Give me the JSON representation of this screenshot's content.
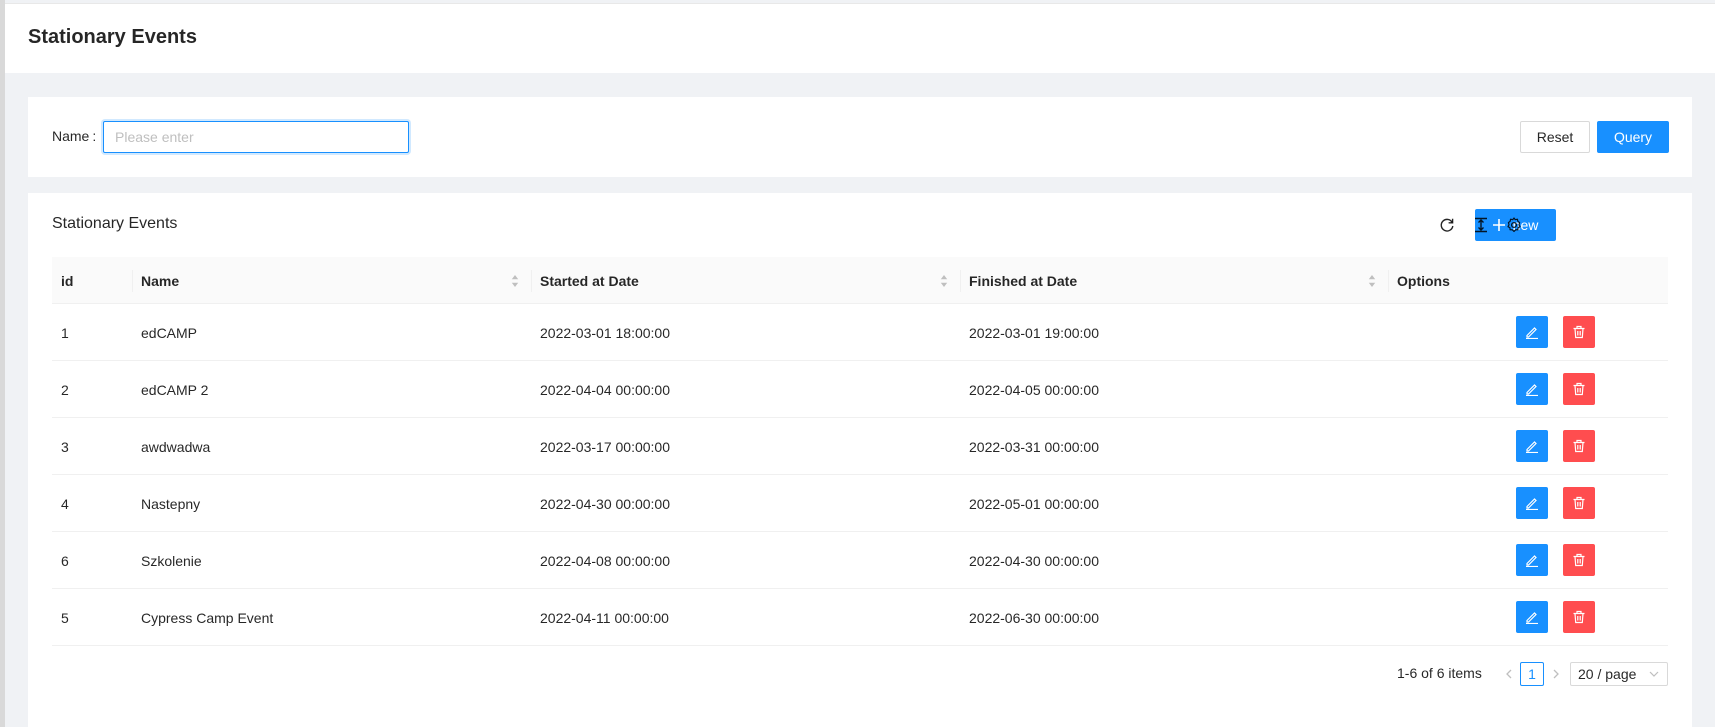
{
  "header": {
    "title": "Stationary Events"
  },
  "search": {
    "label": "Name",
    "colon": ":",
    "placeholder": "Please enter",
    "value": "",
    "reset_label": "Reset",
    "query_label": "Query"
  },
  "table_card": {
    "title": "Stationary Events",
    "new_label": "new",
    "tool_icons": [
      "reload-icon",
      "column-height-icon",
      "setting-icon"
    ]
  },
  "table": {
    "columns": [
      {
        "label": "id",
        "sortable": false
      },
      {
        "label": "Name",
        "sortable": true
      },
      {
        "label": "Started at Date",
        "sortable": true
      },
      {
        "label": "Finished at Date",
        "sortable": true
      },
      {
        "label": "Options",
        "sortable": false
      }
    ],
    "rows": [
      {
        "id": "1",
        "name": "edCAMP",
        "started": "2022-03-01 18:00:00",
        "finished": "2022-03-01 19:00:00"
      },
      {
        "id": "2",
        "name": "edCAMP 2",
        "started": "2022-04-04 00:00:00",
        "finished": "2022-04-05 00:00:00"
      },
      {
        "id": "3",
        "name": "awdwadwa",
        "started": "2022-03-17 00:00:00",
        "finished": "2022-03-31 00:00:00"
      },
      {
        "id": "4",
        "name": "Nastepny",
        "started": "2022-04-30 00:00:00",
        "finished": "2022-05-01 00:00:00"
      },
      {
        "id": "6",
        "name": "Szkolenie",
        "started": "2022-04-08 00:00:00",
        "finished": "2022-04-30 00:00:00"
      },
      {
        "id": "5",
        "name": "Cypress Camp Event",
        "started": "2022-04-11 00:00:00",
        "finished": "2022-06-30 00:00:00"
      }
    ]
  },
  "pagination": {
    "total_text": "1-6 of 6 items",
    "current_page": "1",
    "page_size": "20 / page"
  },
  "colors": {
    "primary": "#1890ff",
    "danger": "#ff4d4f"
  }
}
